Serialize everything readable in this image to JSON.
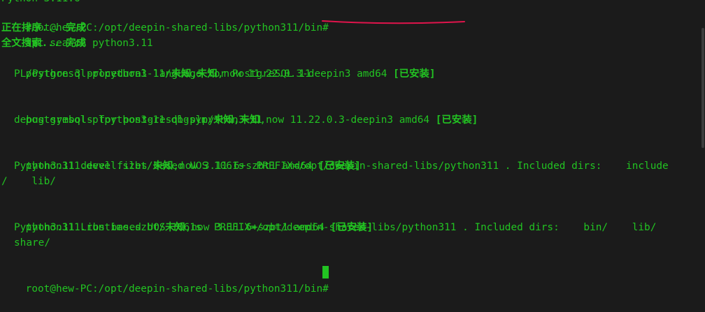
{
  "terminal": {
    "partial_top": "Python 3.11.6",
    "command_line": {
      "prompt": "root@hew-PC:/opt/deepin-shared-libs/python311/bin#",
      "command": "apt search python3.11"
    },
    "status_sort": "正在排序... 完成",
    "status_search": "全文搜索... 完成",
    "packages": [
      {
        "name": "postgresql-plpython3-11/",
        "suite": "未知,未知",
        "version_arch": ",now 11.22.0.3-deepin3 amd64 ",
        "installed": "[已安装]",
        "desc": [
          "PL/Python 3 procedural language for PostgreSQL 11"
        ]
      },
      {
        "name": "postgresql-plpython3-11-dbgsym/",
        "suite": "未知,未知",
        "version_arch": ",now 11.22.0.3-deepin3 amd64 ",
        "installed": "[已安装]",
        "desc": [
          "debug symbols for postgresql-plpython3-11"
        ]
      },
      {
        "name": "python311.devel.szbt/",
        "suite": "未知",
        "version_arch": ",now 3.11.6+szbt1 amd64 ",
        "installed": "[已安装]",
        "desc": [
          "Python3.11 devel files based UOS 1061s  PREFIX=/opt/deepin-shared-libs/python311 . Included dirs:    include",
          "/    lib/"
        ]
      },
      {
        "name": "python311.runtime.szbt/",
        "suite": "未知",
        "version_arch": ",now 3.11.6+szbt1 amd64 ",
        "installed": "[已安装]",
        "desc": [
          "Python3.11 Libs based UOS 1061s  PREFIX=/opt/deepin-shared-libs/python311 . Included dirs:    bin/    lib/",
          "share/"
        ]
      }
    ],
    "final_prompt": "root@hew-PC:/opt/deepin-shared-libs/python311/bin#",
    "colors": {
      "background": "#1b1b1b",
      "text": "#22c322",
      "annotation": "#e0144c"
    }
  }
}
